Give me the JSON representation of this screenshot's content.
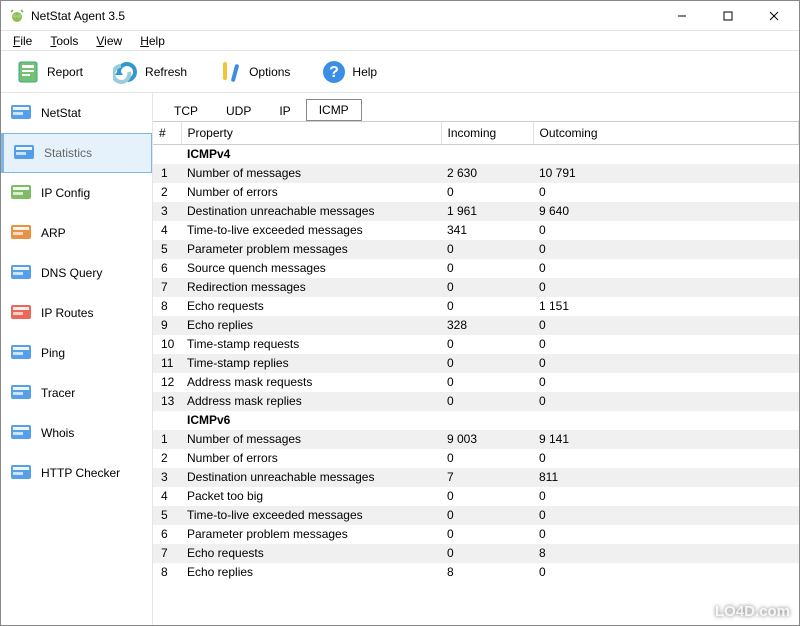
{
  "window": {
    "title": "NetStat Agent 3.5"
  },
  "menubar": {
    "file": "File",
    "tools": "Tools",
    "view": "View",
    "help": "Help"
  },
  "toolbar": {
    "report": "Report",
    "refresh": "Refresh",
    "options": "Options",
    "help": "Help"
  },
  "sidebar": {
    "items": [
      {
        "label": "NetStat",
        "icon": "globe-icon"
      },
      {
        "label": "Statistics",
        "icon": "clock-stats-icon",
        "selected": true
      },
      {
        "label": "IP Config",
        "icon": "server-green-icon"
      },
      {
        "label": "ARP",
        "icon": "server-orange-icon"
      },
      {
        "label": "DNS Query",
        "icon": "dns-search-icon"
      },
      {
        "label": "IP Routes",
        "icon": "routes-icon"
      },
      {
        "label": "Ping",
        "icon": "ping-icon"
      },
      {
        "label": "Tracer",
        "icon": "tracer-icon"
      },
      {
        "label": "Whois",
        "icon": "whois-icon"
      },
      {
        "label": "HTTP Checker",
        "icon": "http-check-icon"
      }
    ]
  },
  "tabs": {
    "items": [
      "TCP",
      "UDP",
      "IP",
      "ICMP"
    ],
    "selected": "ICMP"
  },
  "columns": {
    "num": "#",
    "property": "Property",
    "incoming": "Incoming",
    "outcoming": "Outcoming"
  },
  "groups": [
    {
      "name": "ICMPv4",
      "rows": [
        {
          "n": 1,
          "p": "Number of messages",
          "in": "2 630",
          "out": "10 791"
        },
        {
          "n": 2,
          "p": "Number of errors",
          "in": "0",
          "out": "0"
        },
        {
          "n": 3,
          "p": "Destination unreachable messages",
          "in": "1 961",
          "out": "9 640"
        },
        {
          "n": 4,
          "p": "Time-to-live exceeded messages",
          "in": "341",
          "out": "0"
        },
        {
          "n": 5,
          "p": "Parameter problem messages",
          "in": "0",
          "out": "0"
        },
        {
          "n": 6,
          "p": "Source quench messages",
          "in": "0",
          "out": "0"
        },
        {
          "n": 7,
          "p": "Redirection messages",
          "in": "0",
          "out": "0"
        },
        {
          "n": 8,
          "p": "Echo requests",
          "in": "0",
          "out": "1 151"
        },
        {
          "n": 9,
          "p": "Echo replies",
          "in": "328",
          "out": "0"
        },
        {
          "n": 10,
          "p": "Time-stamp requests",
          "in": "0",
          "out": "0"
        },
        {
          "n": 11,
          "p": "Time-stamp replies",
          "in": "0",
          "out": "0"
        },
        {
          "n": 12,
          "p": "Address mask requests",
          "in": "0",
          "out": "0"
        },
        {
          "n": 13,
          "p": "Address mask replies",
          "in": "0",
          "out": "0"
        }
      ]
    },
    {
      "name": "ICMPv6",
      "rows": [
        {
          "n": 1,
          "p": "Number of messages",
          "in": "9 003",
          "out": "9 141"
        },
        {
          "n": 2,
          "p": "Number of errors",
          "in": "0",
          "out": "0"
        },
        {
          "n": 3,
          "p": "Destination unreachable messages",
          "in": "7",
          "out": "811"
        },
        {
          "n": 4,
          "p": "Packet too big",
          "in": "0",
          "out": "0"
        },
        {
          "n": 5,
          "p": "Time-to-live exceeded messages",
          "in": "0",
          "out": "0"
        },
        {
          "n": 6,
          "p": "Parameter problem messages",
          "in": "0",
          "out": "0"
        },
        {
          "n": 7,
          "p": "Echo requests",
          "in": "0",
          "out": "8"
        },
        {
          "n": 8,
          "p": "Echo replies",
          "in": "8",
          "out": "0"
        }
      ]
    }
  ],
  "watermark": "LO4D.com"
}
